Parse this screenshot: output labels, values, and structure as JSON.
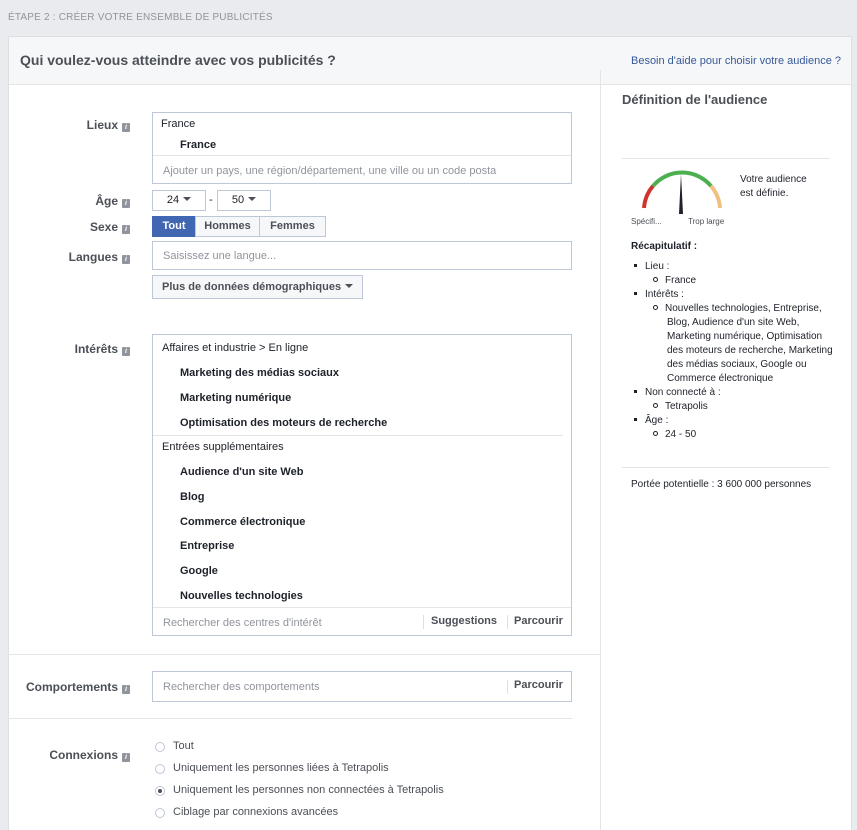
{
  "step_label": "ÉTAPE 2 : CRÉER VOTRE ENSEMBLE DE PUBLICITÉS",
  "header": {
    "title": "Qui voulez-vous atteindre avec vos publicités ?",
    "help_link": "Besoin d'aide pour choisir votre audience ?"
  },
  "locations": {
    "label": "Lieux",
    "country_group": "France",
    "selected": "France",
    "placeholder": "Ajouter un pays, une région/département, une ville ou un code posta"
  },
  "age": {
    "label": "Âge",
    "min": "24",
    "separator": "-",
    "max": "50"
  },
  "gender": {
    "label": "Sexe",
    "options": [
      "Tout",
      "Hommes",
      "Femmes"
    ],
    "selected": "Tout"
  },
  "languages": {
    "label": "Langues",
    "placeholder": "Saisissez une langue..."
  },
  "more_demographics": "Plus de données démographiques",
  "interests": {
    "label": "Intérêts",
    "group1_title": "Affaires et industrie > En ligne",
    "group1_items": [
      "Marketing des médias sociaux",
      "Marketing numérique",
      "Optimisation des moteurs de recherche"
    ],
    "group2_title": "Entrées supplémentaires",
    "group2_items": [
      "Audience d'un site Web",
      "Blog",
      "Commerce électronique",
      "Entreprise",
      "Google",
      "Nouvelles technologies"
    ],
    "search_placeholder": "Rechercher des centres d'intérêt",
    "suggestions": "Suggestions",
    "browse": "Parcourir"
  },
  "behaviors": {
    "label": "Comportements",
    "placeholder": "Rechercher des comportements",
    "browse": "Parcourir"
  },
  "connections": {
    "label": "Connexions",
    "options": [
      "Tout",
      "Uniquement les personnes liées à Tetrapolis",
      "Uniquement les personnes non connectées à Tetrapolis",
      "Ciblage par connexions avancées"
    ],
    "selected_index": 2
  },
  "audience": {
    "title": "Définition de l'audience",
    "status": "Votre audience est définie.",
    "gauge_left": "Spécifi...",
    "gauge_right": "Trop large",
    "gauge_level": 0.5,
    "summary_title": "Récapitulatif :",
    "summary": [
      {
        "label": "Lieu :",
        "value": "France"
      },
      {
        "label": "Intérêts :",
        "value": "Nouvelles technologies, Entreprise, Blog, Audience d'un site Web, Marketing numérique, Optimisation des moteurs de recherche, Marketing des médias sociaux, Google ou Commerce électronique"
      },
      {
        "label": "Non connecté à :",
        "value": "Tetrapolis"
      },
      {
        "label": "Âge :",
        "value": "24 - 50"
      }
    ],
    "reach": "Portée potentielle : 3 600 000 personnes"
  },
  "colors": {
    "accent": "#4267b2",
    "link": "#365899",
    "gauge_red": "#d0342c",
    "gauge_green": "#4caf50",
    "gauge_orange": "#f0c080"
  },
  "icons": [
    "info-icon",
    "caret-down-icon",
    "gauge-needle-icon"
  ]
}
